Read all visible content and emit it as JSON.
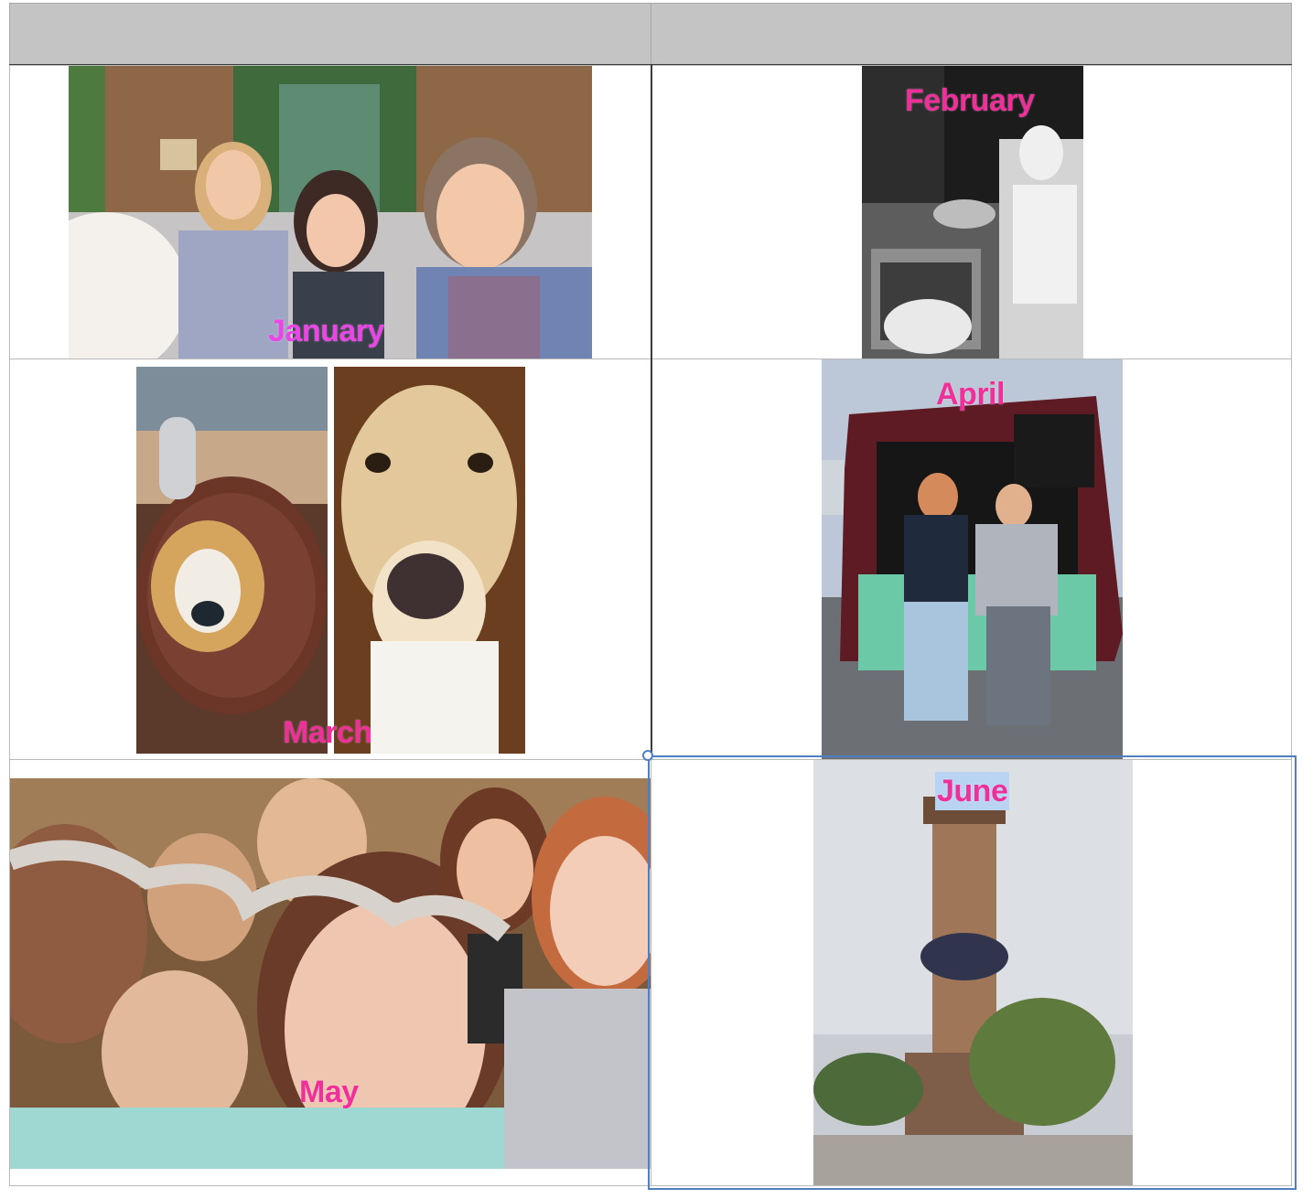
{
  "header": {
    "col1": "",
    "col2": ""
  },
  "months": {
    "january": "January",
    "february": "February",
    "march": "March",
    "april": "April",
    "may": "May",
    "june": "June"
  },
  "label_color": "#f0309a",
  "selection_color": "#4f7fc0"
}
